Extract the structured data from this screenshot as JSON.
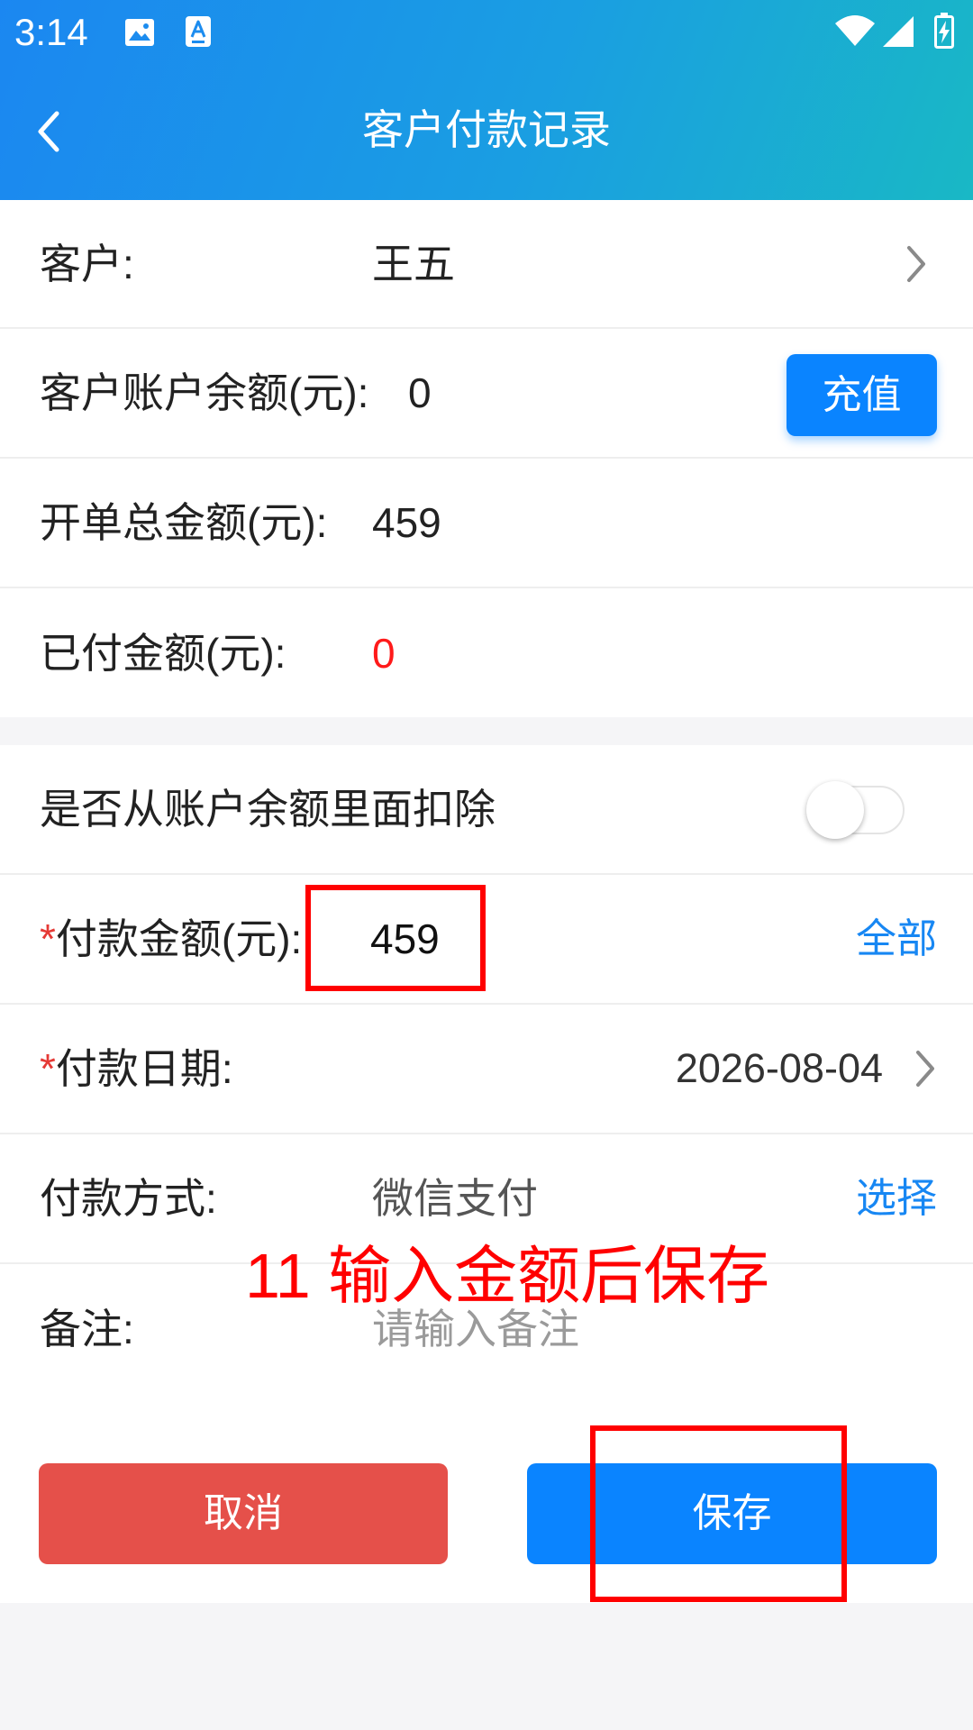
{
  "status_bar": {
    "time": "3:14",
    "notification_icons": [
      "image-icon",
      "text-a-icon"
    ],
    "system_icons": [
      "wifi-icon",
      "cellular-signal-icon",
      "battery-charging-icon"
    ]
  },
  "header": {
    "title": "客户付款记录",
    "back_icon": "chevron-left-icon"
  },
  "colors": {
    "header_start": "#1b87f1",
    "header_end": "#19b8c5",
    "accent": "#0a84ff",
    "link": "#1787f3",
    "cancel": "#e5504a",
    "alert": "#ff1a1a",
    "required": "#e53935",
    "annotation": "#ff0000",
    "page_background": "#f5f5f7"
  },
  "form": {
    "customer": {
      "label": "客户:",
      "value": "王五",
      "icon": "chevron-right-icon"
    },
    "balance": {
      "label": "客户账户余额(元):",
      "value": "0",
      "recharge_label": "充值"
    },
    "order_total": {
      "label": "开单总金额(元):",
      "value": "459"
    },
    "paid_amount": {
      "label": "已付金额(元):",
      "value": "0"
    },
    "deduct_from_balance": {
      "label": "是否从账户余额里面扣除",
      "enabled": false
    },
    "payment_amount": {
      "required_mark": "*",
      "label": "付款金额(元):",
      "value": "459",
      "all_label": "全部"
    },
    "payment_date": {
      "required_mark": "*",
      "label": "付款日期:",
      "value": "2026-08-04",
      "icon": "chevron-right-icon"
    },
    "payment_method": {
      "label": "付款方式:",
      "value": "微信支付",
      "select_label": "选择"
    },
    "remark": {
      "label": "备注:",
      "placeholder": "请输入备注"
    }
  },
  "actions": {
    "cancel_label": "取消",
    "save_label": "保存"
  },
  "annotation": {
    "text": "11 输入金额后保存"
  }
}
